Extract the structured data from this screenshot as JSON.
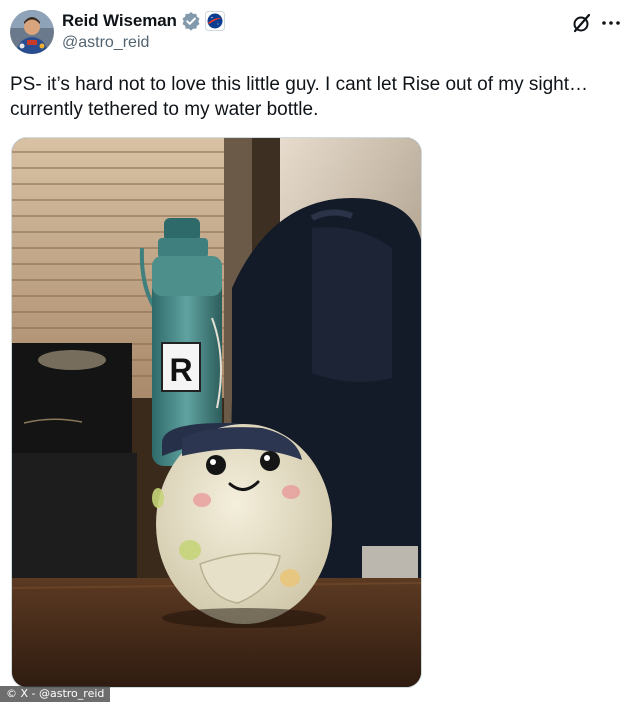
{
  "author": {
    "display_name": "Reid Wiseman",
    "handle": "@astro_reid",
    "avatar_icon": "astronaut-avatar",
    "verified_icon": "verified-badge-icon",
    "affiliation_icon": "nasa-logo-icon"
  },
  "header": {
    "grok_icon": "grok-icon",
    "more_icon": "more-options-icon"
  },
  "tweet": {
    "text": "PS- it’s hard not to love this little guy. I cant let Rise out of my sight… currently tethered to my water bottle."
  },
  "media": {
    "description_icon": "photo",
    "bottle_label": "R"
  },
  "watermark": {
    "text": "© X - @astro_reid"
  },
  "colors": {
    "text_primary": "#0f1419",
    "text_secondary": "#536471",
    "verified_gray": "#829aab",
    "nasa_blue": "#0b3d91",
    "nasa_red": "#fc3d21"
  }
}
